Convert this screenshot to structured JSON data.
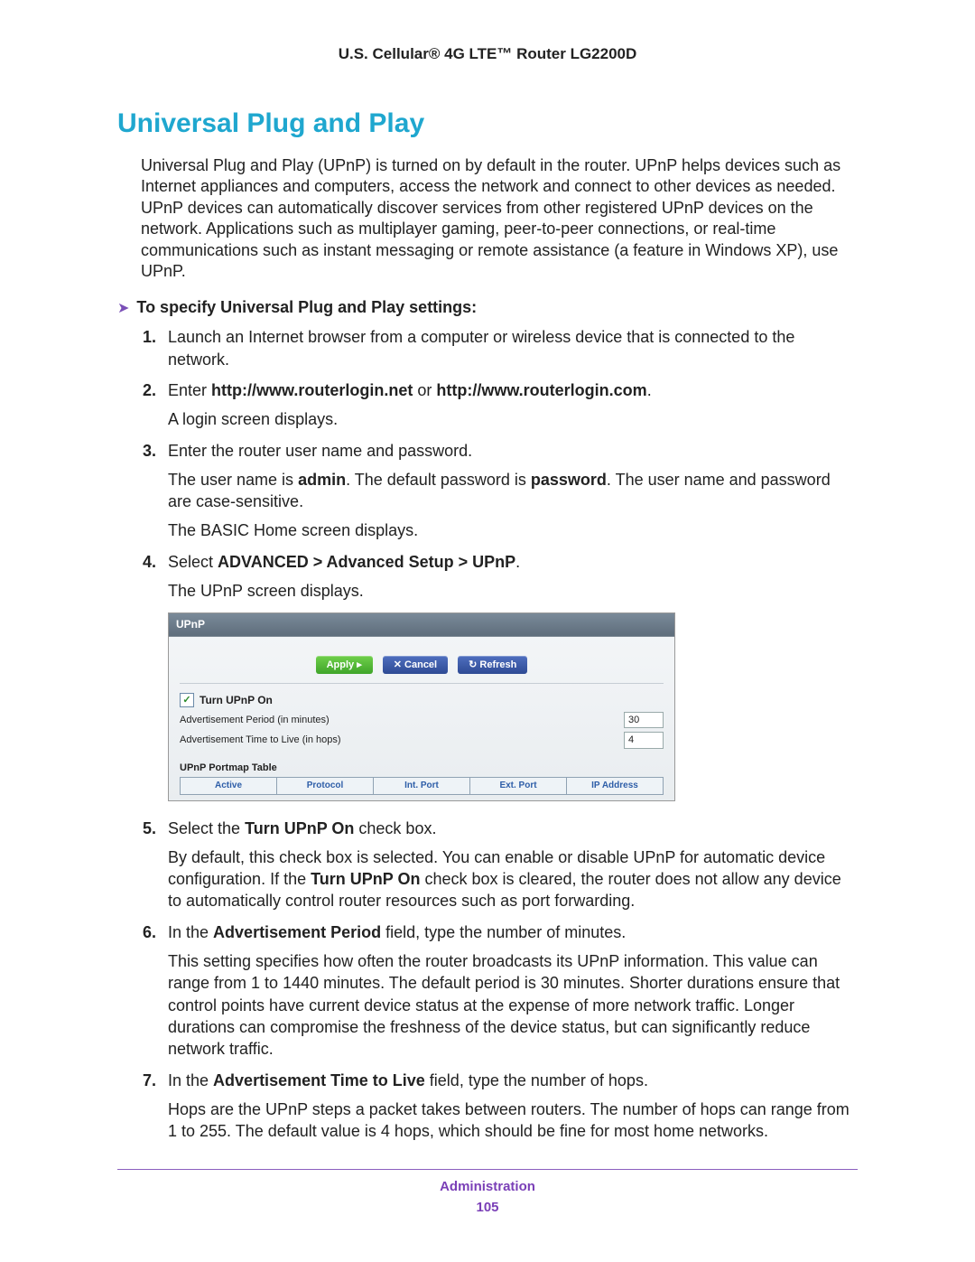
{
  "header": {
    "product": "U.S. Cellular® 4G LTE™ Router LG2200D"
  },
  "title": "Universal Plug and Play",
  "intro": "Universal Plug and Play (UPnP) is turned on by default in the router. UPnP helps devices such as Internet appliances and computers, access the network and connect to other devices as needed. UPnP devices can automatically discover services from other registered UPnP devices on the network. Applications such as multiplayer gaming, peer-to-peer connections, or real-time communications such as instant messaging or remote assistance (a feature in Windows XP), use UPnP.",
  "task_lead": "To specify Universal Plug and Play settings:",
  "steps": {
    "s1": "Launch an Internet browser from a computer or wireless device that is connected to the network.",
    "s2a": "Enter ",
    "s2b": "http://www.routerlogin.net",
    "s2c": " or ",
    "s2d": "http://www.routerlogin.com",
    "s2e": ".",
    "s2sub": "A login screen displays.",
    "s3": "Enter the router user name and password.",
    "s3suba": "The user name is ",
    "s3subb": "admin",
    "s3subc": ". The default password is ",
    "s3subd": "password",
    "s3sube": ". The user name and password are case-sensitive.",
    "s3sub2": "The BASIC Home screen displays.",
    "s4a": "Select ",
    "s4b": "ADVANCED > Advanced Setup > UPnP",
    "s4c": ".",
    "s4sub": "The UPnP screen displays.",
    "s5a": "Select the ",
    "s5b": "Turn UPnP On",
    "s5c": " check box.",
    "s5suba": "By default, this check box is selected. You can enable or disable UPnP for automatic device configuration. If the ",
    "s5subb": "Turn UPnP On",
    "s5subc": " check box is cleared, the router does not allow any device to automatically control router resources such as port forwarding.",
    "s6a": "In the ",
    "s6b": "Advertisement Period",
    "s6c": " field, type the number of minutes.",
    "s6sub": "This setting specifies how often the router broadcasts its UPnP information. This value can range from 1 to 1440 minutes. The default period is 30 minutes. Shorter durations ensure that control points have current device status at the expense of more network traffic. Longer durations can compromise the freshness of the device status, but can significantly reduce network traffic.",
    "s7a": "In the ",
    "s7b": "Advertisement Time to Live",
    "s7c": " field, type the number of hops.",
    "s7sub": "Hops are the UPnP steps a packet takes between routers. The number of hops can range from 1 to 255. The default value is 4 hops, which should be fine for most home networks."
  },
  "upnp_ui": {
    "title": "UPnP",
    "apply": "Apply ▸",
    "cancel": "✕ Cancel",
    "refresh": "↻ Refresh",
    "chk_label": "Turn UPnP On",
    "adv_period_label": "Advertisement Period (in minutes)",
    "adv_period_value": "30",
    "adv_ttl_label": "Advertisement Time to Live (in hops)",
    "adv_ttl_value": "4",
    "table_title": "UPnP Portmap Table",
    "cols": {
      "c1": "Active",
      "c2": "Protocol",
      "c3": "Int. Port",
      "c4": "Ext. Port",
      "c5": "IP Address"
    }
  },
  "footer": {
    "section": "Administration",
    "page": "105"
  }
}
